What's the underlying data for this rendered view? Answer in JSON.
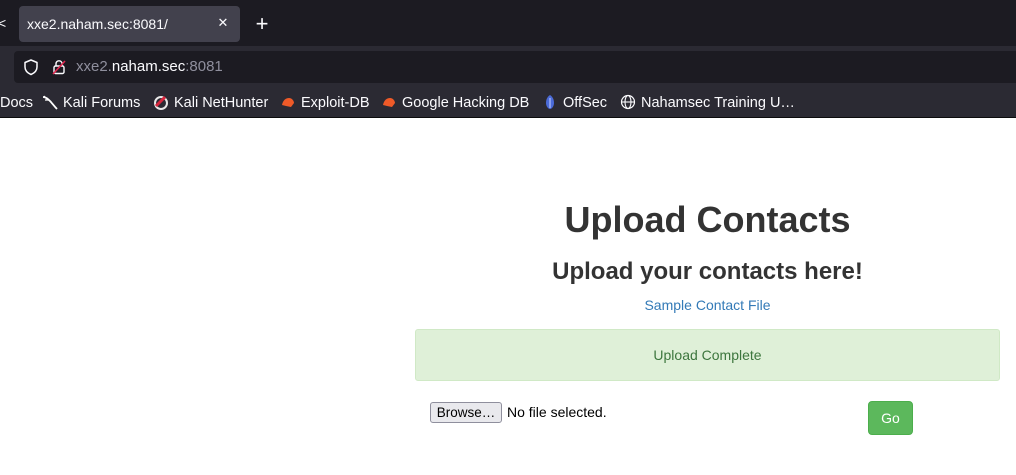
{
  "browser": {
    "prev_tab_glyph": "<",
    "active_tab": {
      "title": "xxe2.naham.sec:8081/",
      "close_glyph": "✕"
    },
    "new_tab_glyph": "+",
    "url": {
      "subdomain": "xxe2.",
      "domain": "naham.sec",
      "port": ":8081"
    },
    "icons": {
      "shield": "shield-icon",
      "lock": "lock-icon"
    },
    "bookmarks": [
      {
        "label": "Docs",
        "icon": null
      },
      {
        "label": "Kali Forums",
        "icon": "kali-dragon-icon"
      },
      {
        "label": "Kali NetHunter",
        "icon": "nethunter-icon"
      },
      {
        "label": "Exploit-DB",
        "icon": "exploitdb-icon"
      },
      {
        "label": "Google Hacking DB",
        "icon": "ghdb-icon"
      },
      {
        "label": "OffSec",
        "icon": "offsec-icon"
      },
      {
        "label": "Nahamsec Training U…",
        "icon": "globe-icon"
      }
    ]
  },
  "page": {
    "title": "Upload Contacts",
    "subtitle": "Upload your contacts here!",
    "sample_link": "Sample Contact File",
    "alert": "Upload Complete",
    "browse_label": "Browse…",
    "file_status": "No file selected.",
    "go_label": "Go"
  },
  "colors": {
    "tabstrip_bg": "#1c1b22",
    "toolbar_bg": "#2b2a33",
    "alert_bg": "#dff0d8",
    "alert_text": "#3c763d",
    "link": "#337ab7",
    "go_button": "#5cb85c"
  }
}
